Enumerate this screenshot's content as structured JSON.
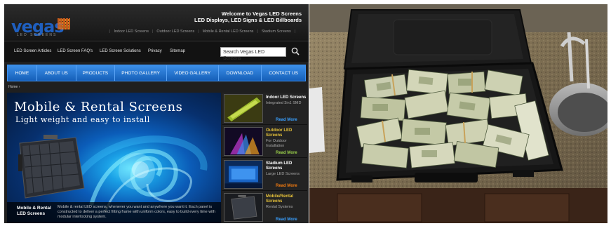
{
  "site": {
    "logo": "vegas",
    "logo_sub": "LED SCREENS",
    "welcome": {
      "line1": "Welcome to Vegas LED Screens",
      "line2": "LED Displays, LED Signs & LED Billboards"
    },
    "top_links": [
      "Indoor LED Screens",
      "Outdoor LED Screens",
      "Mobile & Rental LED Screens",
      "Stadium Screens"
    ],
    "sub_nav": [
      "LED Screen Articles",
      "LED Screen FAQ's",
      "LED Screen Solutions",
      "Privacy",
      "Sitemap"
    ],
    "search": {
      "value": "Search Vegas LED Screens"
    },
    "main_nav": [
      "HOME",
      "ABOUT US",
      "PRODUCTS",
      "PHOTO GALLERY",
      "VIDEO GALLERY",
      "DOWNLOAD",
      "CONTACT US"
    ],
    "breadcrumb": "Home ›",
    "hero": {
      "title": "Mobile & Rental Screens",
      "subtitle": "Light weight and easy to install",
      "caption_title_1": "Mobile & Rental",
      "caption_title_2": "LED Screens",
      "caption_text": "Mobile & rental LED screens, whenever you want and anywhere you want it. Each panel is constructed to deliver a perfect fitting frame with uniform colors, easy to build every time with modular interlocking system."
    },
    "sidebar": [
      {
        "title": "Indoor LED Screens",
        "desc": "Integrated 3in1 SMD",
        "more": "Read More"
      },
      {
        "title": "Outdoor LED Screens",
        "desc": "For Outdoor Installation",
        "more": "Read More"
      },
      {
        "title": "Stadium LED Screens",
        "desc": "Large LED Screens",
        "more": "Read More"
      },
      {
        "title": "Mobile/Rental Screens",
        "desc": "Rental Systems",
        "more": "Read More"
      }
    ],
    "colors": {
      "nav_blue": "#1c6fd0",
      "read_more_blue": "#3aa0ff",
      "read_more_orange": "#f07a10",
      "accent_gold": "#e6c23a"
    }
  },
  "icons": [
    "search-icon"
  ]
}
